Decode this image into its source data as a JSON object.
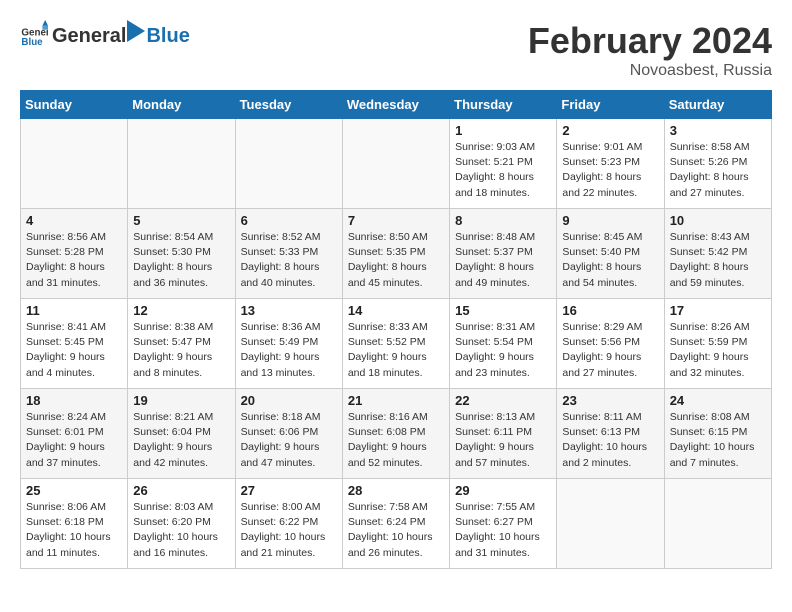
{
  "header": {
    "logo_general": "General",
    "logo_blue": "Blue",
    "month": "February 2024",
    "location": "Novoasbest, Russia"
  },
  "weekdays": [
    "Sunday",
    "Monday",
    "Tuesday",
    "Wednesday",
    "Thursday",
    "Friday",
    "Saturday"
  ],
  "weeks": [
    [
      {
        "day": "",
        "sunrise": "",
        "sunset": "",
        "daylight": ""
      },
      {
        "day": "",
        "sunrise": "",
        "sunset": "",
        "daylight": ""
      },
      {
        "day": "",
        "sunrise": "",
        "sunset": "",
        "daylight": ""
      },
      {
        "day": "",
        "sunrise": "",
        "sunset": "",
        "daylight": ""
      },
      {
        "day": "1",
        "sunrise": "Sunrise: 9:03 AM",
        "sunset": "Sunset: 5:21 PM",
        "daylight": "Daylight: 8 hours and 18 minutes."
      },
      {
        "day": "2",
        "sunrise": "Sunrise: 9:01 AM",
        "sunset": "Sunset: 5:23 PM",
        "daylight": "Daylight: 8 hours and 22 minutes."
      },
      {
        "day": "3",
        "sunrise": "Sunrise: 8:58 AM",
        "sunset": "Sunset: 5:26 PM",
        "daylight": "Daylight: 8 hours and 27 minutes."
      }
    ],
    [
      {
        "day": "4",
        "sunrise": "Sunrise: 8:56 AM",
        "sunset": "Sunset: 5:28 PM",
        "daylight": "Daylight: 8 hours and 31 minutes."
      },
      {
        "day": "5",
        "sunrise": "Sunrise: 8:54 AM",
        "sunset": "Sunset: 5:30 PM",
        "daylight": "Daylight: 8 hours and 36 minutes."
      },
      {
        "day": "6",
        "sunrise": "Sunrise: 8:52 AM",
        "sunset": "Sunset: 5:33 PM",
        "daylight": "Daylight: 8 hours and 40 minutes."
      },
      {
        "day": "7",
        "sunrise": "Sunrise: 8:50 AM",
        "sunset": "Sunset: 5:35 PM",
        "daylight": "Daylight: 8 hours and 45 minutes."
      },
      {
        "day": "8",
        "sunrise": "Sunrise: 8:48 AM",
        "sunset": "Sunset: 5:37 PM",
        "daylight": "Daylight: 8 hours and 49 minutes."
      },
      {
        "day": "9",
        "sunrise": "Sunrise: 8:45 AM",
        "sunset": "Sunset: 5:40 PM",
        "daylight": "Daylight: 8 hours and 54 minutes."
      },
      {
        "day": "10",
        "sunrise": "Sunrise: 8:43 AM",
        "sunset": "Sunset: 5:42 PM",
        "daylight": "Daylight: 8 hours and 59 minutes."
      }
    ],
    [
      {
        "day": "11",
        "sunrise": "Sunrise: 8:41 AM",
        "sunset": "Sunset: 5:45 PM",
        "daylight": "Daylight: 9 hours and 4 minutes."
      },
      {
        "day": "12",
        "sunrise": "Sunrise: 8:38 AM",
        "sunset": "Sunset: 5:47 PM",
        "daylight": "Daylight: 9 hours and 8 minutes."
      },
      {
        "day": "13",
        "sunrise": "Sunrise: 8:36 AM",
        "sunset": "Sunset: 5:49 PM",
        "daylight": "Daylight: 9 hours and 13 minutes."
      },
      {
        "day": "14",
        "sunrise": "Sunrise: 8:33 AM",
        "sunset": "Sunset: 5:52 PM",
        "daylight": "Daylight: 9 hours and 18 minutes."
      },
      {
        "day": "15",
        "sunrise": "Sunrise: 8:31 AM",
        "sunset": "Sunset: 5:54 PM",
        "daylight": "Daylight: 9 hours and 23 minutes."
      },
      {
        "day": "16",
        "sunrise": "Sunrise: 8:29 AM",
        "sunset": "Sunset: 5:56 PM",
        "daylight": "Daylight: 9 hours and 27 minutes."
      },
      {
        "day": "17",
        "sunrise": "Sunrise: 8:26 AM",
        "sunset": "Sunset: 5:59 PM",
        "daylight": "Daylight: 9 hours and 32 minutes."
      }
    ],
    [
      {
        "day": "18",
        "sunrise": "Sunrise: 8:24 AM",
        "sunset": "Sunset: 6:01 PM",
        "daylight": "Daylight: 9 hours and 37 minutes."
      },
      {
        "day": "19",
        "sunrise": "Sunrise: 8:21 AM",
        "sunset": "Sunset: 6:04 PM",
        "daylight": "Daylight: 9 hours and 42 minutes."
      },
      {
        "day": "20",
        "sunrise": "Sunrise: 8:18 AM",
        "sunset": "Sunset: 6:06 PM",
        "daylight": "Daylight: 9 hours and 47 minutes."
      },
      {
        "day": "21",
        "sunrise": "Sunrise: 8:16 AM",
        "sunset": "Sunset: 6:08 PM",
        "daylight": "Daylight: 9 hours and 52 minutes."
      },
      {
        "day": "22",
        "sunrise": "Sunrise: 8:13 AM",
        "sunset": "Sunset: 6:11 PM",
        "daylight": "Daylight: 9 hours and 57 minutes."
      },
      {
        "day": "23",
        "sunrise": "Sunrise: 8:11 AM",
        "sunset": "Sunset: 6:13 PM",
        "daylight": "Daylight: 10 hours and 2 minutes."
      },
      {
        "day": "24",
        "sunrise": "Sunrise: 8:08 AM",
        "sunset": "Sunset: 6:15 PM",
        "daylight": "Daylight: 10 hours and 7 minutes."
      }
    ],
    [
      {
        "day": "25",
        "sunrise": "Sunrise: 8:06 AM",
        "sunset": "Sunset: 6:18 PM",
        "daylight": "Daylight: 10 hours and 11 minutes."
      },
      {
        "day": "26",
        "sunrise": "Sunrise: 8:03 AM",
        "sunset": "Sunset: 6:20 PM",
        "daylight": "Daylight: 10 hours and 16 minutes."
      },
      {
        "day": "27",
        "sunrise": "Sunrise: 8:00 AM",
        "sunset": "Sunset: 6:22 PM",
        "daylight": "Daylight: 10 hours and 21 minutes."
      },
      {
        "day": "28",
        "sunrise": "Sunrise: 7:58 AM",
        "sunset": "Sunset: 6:24 PM",
        "daylight": "Daylight: 10 hours and 26 minutes."
      },
      {
        "day": "29",
        "sunrise": "Sunrise: 7:55 AM",
        "sunset": "Sunset: 6:27 PM",
        "daylight": "Daylight: 10 hours and 31 minutes."
      },
      {
        "day": "",
        "sunrise": "",
        "sunset": "",
        "daylight": ""
      },
      {
        "day": "",
        "sunrise": "",
        "sunset": "",
        "daylight": ""
      }
    ]
  ]
}
